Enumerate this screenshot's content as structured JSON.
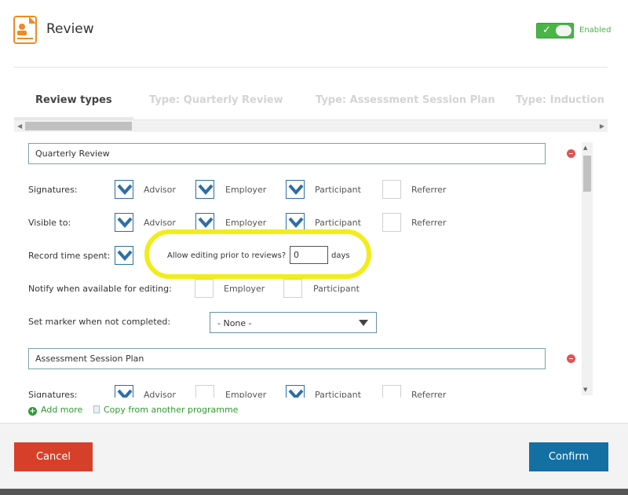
{
  "header": {
    "title": "Review",
    "toggle_label": "Enabled",
    "toggle_check": "✓"
  },
  "tabs": [
    {
      "label": "Review types"
    },
    {
      "label": "Type: Quarterly Review"
    },
    {
      "label": "Type: Assessment Session Plan"
    },
    {
      "label": "Type: Induction Pr"
    }
  ],
  "sections": [
    {
      "name": "Quarterly Review",
      "signatures": {
        "label": "Signatures:",
        "advisor": "Advisor",
        "employer": "Employer",
        "participant": "Participant",
        "referrer": "Referrer"
      },
      "visible_to": {
        "label": "Visible to:",
        "advisor": "Advisor",
        "employer": "Employer",
        "participant": "Participant",
        "referrer": "Referrer"
      },
      "record_time": {
        "label": "Record time spent:",
        "allow_label": "Allow editing prior to reviews?",
        "days_value": "0",
        "days_unit": "days"
      },
      "notify": {
        "label": "Notify when available for editing:",
        "employer": "Employer",
        "participant": "Participant"
      },
      "marker": {
        "label": "Set marker when not completed:",
        "value": "- None -"
      }
    },
    {
      "name": "Assessment Session Plan",
      "signatures": {
        "label": "Signatures:",
        "advisor": "Advisor",
        "employer": "Employer",
        "participant": "Participant",
        "referrer": "Referrer"
      }
    }
  ],
  "links": {
    "add_more": "Add more",
    "add_more_plus": "+",
    "copy": "Copy from another programme"
  },
  "buttons": {
    "cancel": "Cancel",
    "confirm": "Confirm"
  },
  "colors": {
    "accent_green": "#48b548",
    "cancel_red": "#d6402a",
    "confirm_blue": "#146fa3",
    "highlight_yellow": "#f2ec1b",
    "check_blue": "#2d6ea5"
  }
}
